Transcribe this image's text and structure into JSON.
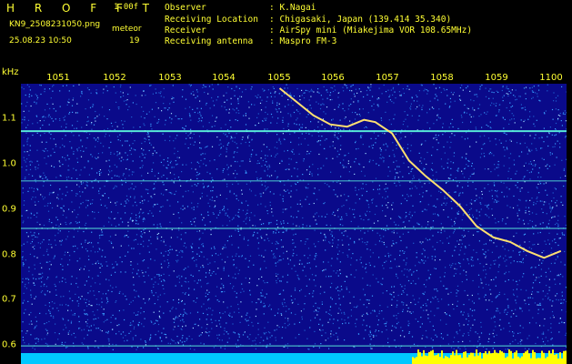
{
  "header": {
    "brand": "H R O F F T",
    "version": "1.00f",
    "filename": "KN9_2508231050.png",
    "datetime": "25.08.23 10:50",
    "meteor_label": "meteor",
    "meteor_count": "19",
    "info": [
      {
        "label": "Observer",
        "value": ": K.Nagai"
      },
      {
        "label": "Receiving Location",
        "value": ": Chigasaki, Japan (139.414 35.340)"
      },
      {
        "label": "Receiver",
        "value": ": AirSpy mini (Miakejima VOR 108.65MHz)"
      },
      {
        "label": "Receiving antenna",
        "value": ": Maspro FM-3"
      }
    ]
  },
  "axes": {
    "y_unit": "kHz",
    "x_ticks": [
      "1051",
      "1052",
      "1053",
      "1054",
      "1055",
      "1056",
      "1057",
      "1058",
      "1059",
      "1100"
    ],
    "y_ticks": [
      "1.1",
      "1.0",
      "0.9",
      "0.8",
      "0.7",
      "0.6"
    ]
  },
  "colors": {
    "background": "#0a0a8a",
    "noise": "#3aa0ff",
    "line": "#60ffe0",
    "trace": "#ffe070",
    "text": "#ffff33",
    "floor": "#00c8ff",
    "floor_hot": "#ffff00"
  },
  "chart_data": {
    "type": "heatmap",
    "x_ticks": [
      "1051",
      "1052",
      "1053",
      "1054",
      "1055",
      "1056",
      "1057",
      "1058",
      "1059",
      "1100"
    ],
    "ylim": [
      0.58,
      1.2
    ],
    "y_ticks": [
      1.1,
      1.0,
      0.9,
      0.8,
      0.7,
      0.6
    ],
    "ylabel": "kHz",
    "horizontal_lines_khz": [
      1.095,
      0.985,
      0.88,
      0.62
    ],
    "trace_khz": [
      {
        "minute": 1055.2,
        "khz": 1.19
      },
      {
        "minute": 1055.5,
        "khz": 1.16
      },
      {
        "minute": 1055.8,
        "khz": 1.13
      },
      {
        "minute": 1056.1,
        "khz": 1.11
      },
      {
        "minute": 1056.4,
        "khz": 1.105
      },
      {
        "minute": 1056.7,
        "khz": 1.12
      },
      {
        "minute": 1056.9,
        "khz": 1.115
      },
      {
        "minute": 1057.2,
        "khz": 1.09
      },
      {
        "minute": 1057.5,
        "khz": 1.03
      },
      {
        "minute": 1057.8,
        "khz": 0.995
      },
      {
        "minute": 1058.1,
        "khz": 0.965
      },
      {
        "minute": 1058.4,
        "khz": 0.93
      },
      {
        "minute": 1058.7,
        "khz": 0.885
      },
      {
        "minute": 1059.0,
        "khz": 0.86
      },
      {
        "minute": 1059.3,
        "khz": 0.85
      },
      {
        "minute": 1059.6,
        "khz": 0.83
      },
      {
        "minute": 1059.9,
        "khz": 0.815
      },
      {
        "minute": 1060.2,
        "khz": 0.83
      }
    ]
  }
}
